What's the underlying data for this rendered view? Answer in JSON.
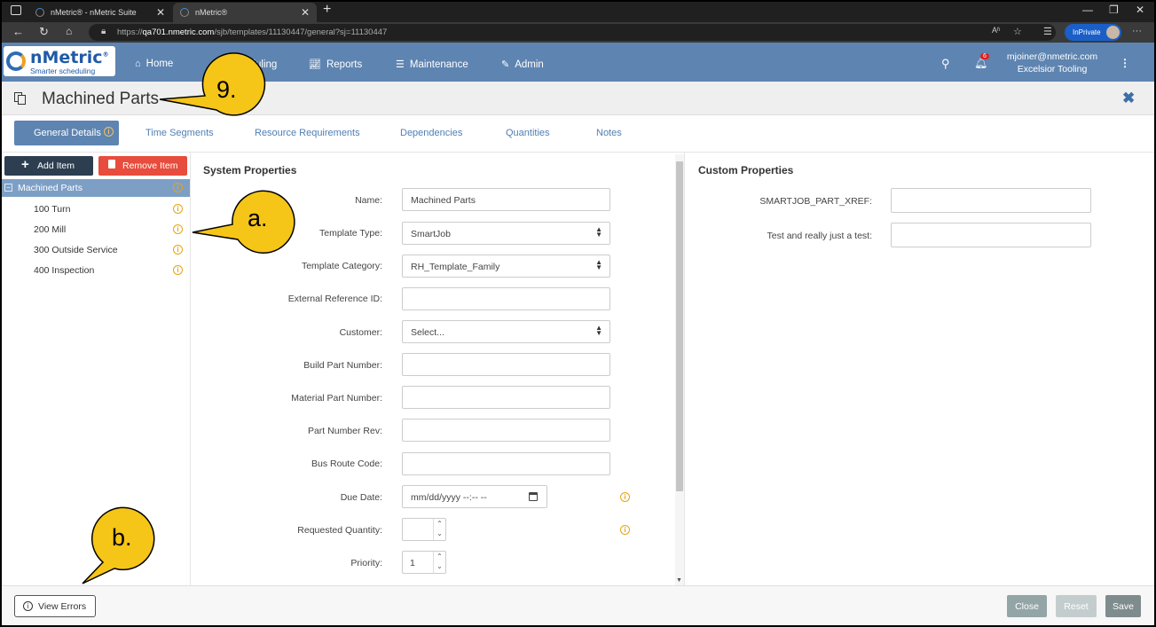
{
  "browser": {
    "tabs": [
      {
        "label": "nMetric® - nMetric Suite"
      },
      {
        "label": "nMetric®"
      }
    ],
    "url_scheme": "https://",
    "url_host": "qa701.nmetric.com",
    "url_path": "/sjb/templates/11130447/general?sj=11130447",
    "inprivate": "InPrivate",
    "read_aloud_icon": "Aʱ"
  },
  "app": {
    "logo_name": "nMetric",
    "logo_reg": "®",
    "logo_tagline": "Smarter scheduling",
    "nav": [
      {
        "label": "Home",
        "icon": "home-icon"
      },
      {
        "label": "Scheduling",
        "icon": "calendar-icon"
      },
      {
        "label": "Reports",
        "icon": "chart-icon"
      },
      {
        "label": "Maintenance",
        "icon": "sliders-icon"
      },
      {
        "label": "Admin",
        "icon": "edit-icon"
      }
    ],
    "notification_count": "6",
    "user_email": "mjoiner@nmetric.com",
    "user_company": "Excelsior Tooling"
  },
  "page": {
    "title": "Machined Parts",
    "tabs": [
      {
        "label": "General Details"
      },
      {
        "label": "Time Segments"
      },
      {
        "label": "Resource Requirements"
      },
      {
        "label": "Dependencies"
      },
      {
        "label": "Quantities"
      },
      {
        "label": "Notes"
      }
    ]
  },
  "tree": {
    "add_label": "Add Item",
    "remove_label": "Remove Item",
    "root": "Machined Parts",
    "children": [
      "100 Turn",
      "200 Mill",
      "300 Outside Service",
      "400 Inspection"
    ]
  },
  "system": {
    "title": "System Properties",
    "fields": [
      {
        "label": "Name:",
        "value": "Machined Parts"
      },
      {
        "label": "Template Type:",
        "value": "SmartJob"
      },
      {
        "label": "Template Category:",
        "value": "RH_Template_Family"
      },
      {
        "label": "External Reference ID:",
        "value": ""
      },
      {
        "label": "Customer:",
        "value": "Select..."
      },
      {
        "label": "Build Part Number:",
        "value": ""
      },
      {
        "label": "Material Part Number:",
        "value": ""
      },
      {
        "label": "Part Number Rev:",
        "value": ""
      },
      {
        "label": "Bus Route Code:",
        "value": ""
      },
      {
        "label": "Due Date:",
        "value": "mm/dd/yyyy --:-- --"
      },
      {
        "label": "Requested Quantity:",
        "value": ""
      },
      {
        "label": "Priority:",
        "value": "1"
      }
    ]
  },
  "custom": {
    "title": "Custom Properties",
    "fields": [
      {
        "label": "SMARTJOB_PART_XREF:",
        "value": ""
      },
      {
        "label": "Test and really just a test:",
        "value": ""
      }
    ]
  },
  "footer": {
    "view_errors": "View Errors",
    "close": "Close",
    "reset": "Reset",
    "save": "Save"
  },
  "callouts": {
    "title_callout": "9.",
    "tree_callout": "a.",
    "errors_callout": "b."
  },
  "colors": {
    "header": "#5e84b1",
    "tree_selected": "#7d9fc5",
    "warning": "#e8a317",
    "remove": "#e74c3c",
    "add": "#2c3e50"
  }
}
